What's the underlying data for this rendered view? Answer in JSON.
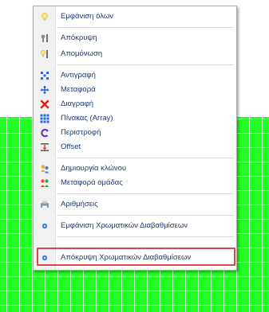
{
  "menu": {
    "items": [
      {
        "icon": "bulb-icon",
        "label": "Εμφάνιση όλων"
      },
      {
        "icon": "hide-icon",
        "label": "Απόκρυψη"
      },
      {
        "icon": "isolate-icon",
        "label": "Απομόνωση"
      },
      {
        "icon": "copy-icon",
        "label": "Αντιγραφή"
      },
      {
        "icon": "move-icon",
        "label": "Μεταφορά"
      },
      {
        "icon": "delete-icon",
        "label": "Διαγραφή"
      },
      {
        "icon": "array-icon",
        "label": "Πίνακας (Array)"
      },
      {
        "icon": "rotate-icon",
        "label": "Περιστροφή"
      },
      {
        "icon": "offset-icon",
        "label": "Offset"
      },
      {
        "icon": "clone-icon",
        "label": "Δημιουργία κλώνου"
      },
      {
        "icon": "group-move-icon",
        "label": "Μεταφορά ομάδας"
      },
      {
        "icon": "numbering-icon",
        "label": "Αριθμήσεις"
      },
      {
        "icon": "show-gradients-icon",
        "label": "Εμφάνιση Χρωματικών Διαβαθμίσεων"
      },
      {
        "icon": "hide-gradients-icon",
        "label": "Απόκρυψη Χρωματικών Διαβαθμίσεων"
      }
    ]
  },
  "colors": {
    "canvas_green": "#22ff22",
    "highlight_border": "#d84a4a",
    "menu_text": "#1d3b74"
  }
}
